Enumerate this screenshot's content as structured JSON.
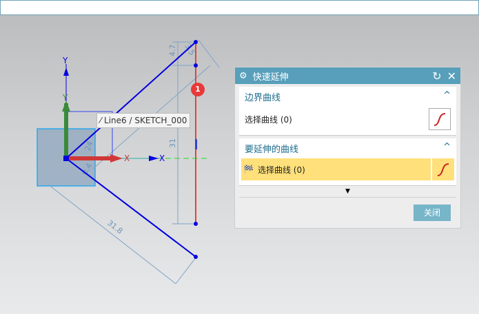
{
  "tooltip": "Line6 / SKETCH_000",
  "badge": "1",
  "axes": {
    "y1": "Y",
    "y2": "Y",
    "x1": "X",
    "x2": "X"
  },
  "dimensions": {
    "d1": "4.7",
    "d2": "3.5",
    "d3": "31",
    "d4": "31.8",
    "d5": "24",
    "d6": "0.4"
  },
  "dialog": {
    "title": "快速延伸",
    "group1": {
      "title": "边界曲线",
      "select": "选择曲线 (0)"
    },
    "group2": {
      "title": "要延伸的曲线",
      "select": "选择曲线 (0)"
    },
    "close": "关闭"
  },
  "colors": {
    "accent": "#579fba",
    "highlight": "#ffe07a",
    "sketch": "#0000e0",
    "selected": "#e0443a"
  }
}
